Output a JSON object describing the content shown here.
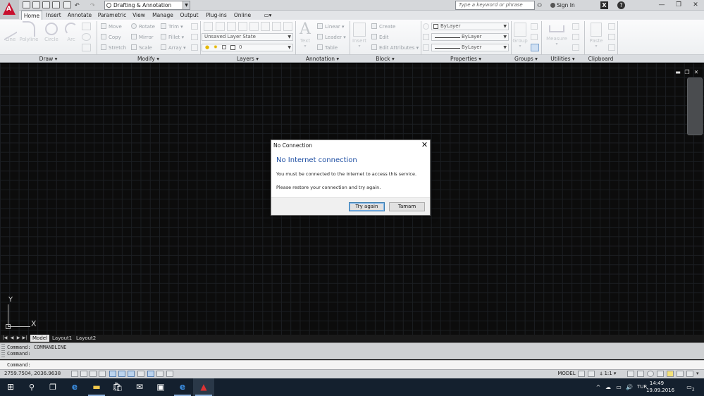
{
  "titlebar": {
    "workspace": "Drafting & Annotation",
    "search_placeholder": "Type a keyword or phrase",
    "sign_in": "Sign In",
    "x_label": "X",
    "help": "?",
    "window_controls": [
      "—",
      "❐",
      "✕"
    ]
  },
  "ribbon_tabs": [
    "Home",
    "Insert",
    "Annotate",
    "Parametric",
    "View",
    "Manage",
    "Output",
    "Plug-ins",
    "Online"
  ],
  "ribbon": {
    "draw": {
      "tools": [
        "Line",
        "Polyline",
        "Circle",
        "Arc"
      ]
    },
    "modify": {
      "col1": [
        "Move",
        "Copy",
        "Stretch"
      ],
      "col2": [
        "Rotate",
        "Mirror",
        "Scale"
      ],
      "col3": [
        "Trim",
        "Fillet",
        "Array"
      ]
    },
    "layers": {
      "layer_state": "Unsaved Layer State",
      "current_layer": "0"
    },
    "annotation": {
      "big": "Text",
      "items": [
        "Linear",
        "Leader",
        "Table"
      ]
    },
    "block": {
      "big": "Insert",
      "items": [
        "Create",
        "Edit",
        "Edit Attributes"
      ]
    },
    "properties": {
      "color": "ByLayer",
      "linetype": "ByLayer",
      "lineweight": "ByLayer"
    },
    "groups": {
      "big": "Group"
    },
    "utilities": {
      "big": "Measure"
    },
    "clipboard": {
      "big": "Paste"
    }
  },
  "panels": [
    "Draw",
    "Modify",
    "Layers",
    "Annotation",
    "Block",
    "Properties",
    "Groups",
    "Utilities",
    "Clipboard"
  ],
  "ucs": {
    "x": "X",
    "y": "Y"
  },
  "layout_tabs": [
    "Model",
    "Layout1",
    "Layout2"
  ],
  "command": {
    "history": [
      "Command: COMMANDLINE",
      "Command:"
    ],
    "prompt": "Command:"
  },
  "status": {
    "coords": "2759.7504, 2036.9638",
    "model": "MODEL",
    "scale": "1:1"
  },
  "taskbar": {
    "language": "TUR",
    "time": "14:49",
    "date": "19.09.2016",
    "notifications": "2"
  },
  "dialog": {
    "title": "No Connection",
    "heading": "No Internet connection",
    "message1": "You must be connected to the Internet to access this service.",
    "message2": "Please restore your connection and try again.",
    "try_again": "Try again",
    "ok": "Tamam"
  }
}
